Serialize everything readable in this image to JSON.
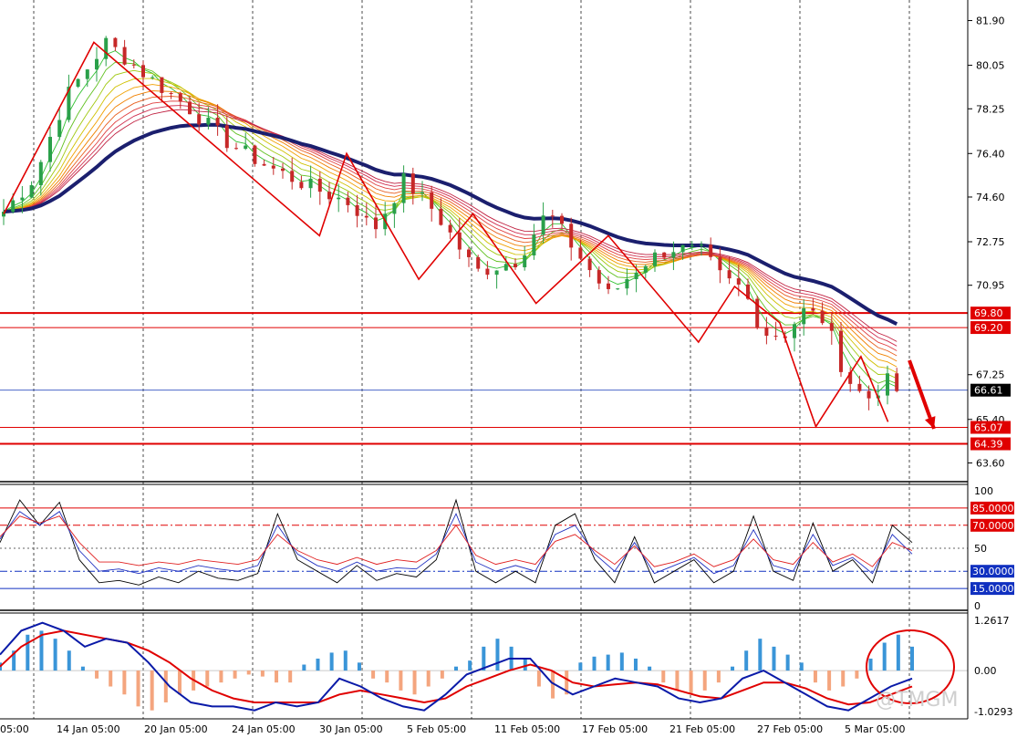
{
  "colors": {
    "background": "#ffffff",
    "grid": "#000000",
    "bull": "#2aa04a",
    "bear": "#c62828",
    "slow_ma": "#1b1f6e",
    "level_red": "#e00000",
    "current_price": "#3050c0",
    "rsi_black": "#000000",
    "rsi_blue": "#2030c0",
    "rsi_red": "#e02020",
    "macd_pos": "#3a95d8",
    "macd_neg": "#f4a57e",
    "macd_main": "#0a1aa8",
    "macd_signal": "#e00000"
  },
  "chart_data": [
    {
      "type": "candlestick",
      "panel": "price",
      "y_axis_ticks": [
        "81.90",
        "80.05",
        "78.25",
        "76.40",
        "74.60",
        "72.75",
        "70.95",
        "67.25",
        "65.40",
        "63.60"
      ],
      "ylim": [
        62.9,
        82.6
      ],
      "x_tick_labels": [
        "05:00",
        "14 Jan 05:00",
        "20 Jan 05:00",
        "24 Jan 05:00",
        "30 Jan 05:00",
        "5 Feb 05:00",
        "11 Feb 05:00",
        "17 Feb 05:00",
        "21 Feb 05:00",
        "27 Feb 05:00",
        "5 Mar 05:00"
      ],
      "price_path": [
        [
          0,
          74.0
        ],
        [
          3,
          75.4
        ],
        [
          6,
          78.7
        ],
        [
          10,
          81.0
        ],
        [
          14,
          79.6
        ],
        [
          18,
          78.3
        ],
        [
          22,
          76.8
        ],
        [
          26,
          75.8
        ],
        [
          30,
          75.0
        ],
        [
          34,
          74.3
        ],
        [
          36,
          73.2
        ],
        [
          39,
          75.3
        ],
        [
          42,
          74.0
        ],
        [
          46,
          71.5
        ],
        [
          50,
          72.0
        ],
        [
          53,
          74.0
        ],
        [
          56,
          72.2
        ],
        [
          59,
          70.5
        ],
        [
          62,
          71.8
        ],
        [
          65,
          72.5
        ],
        [
          68,
          72.3
        ],
        [
          70,
          71.2
        ],
        [
          72,
          70.8
        ],
        [
          74,
          69.0
        ],
        [
          76,
          68.9
        ],
        [
          78,
          69.9
        ],
        [
          80,
          69.5
        ],
        [
          82,
          67.2
        ],
        [
          84,
          66.2
        ],
        [
          86,
          67.0
        ],
        [
          87,
          66.6
        ]
      ],
      "horizontal_levels": [
        "69.80",
        "69.20",
        "65.07",
        "64.39"
      ],
      "current_price": "66.61",
      "zigzag": [
        [
          0,
          73.9
        ],
        [
          10,
          81.0
        ],
        [
          35,
          73.0
        ],
        [
          38,
          76.4
        ],
        [
          46,
          71.2
        ],
        [
          52,
          73.9
        ],
        [
          59,
          70.2
        ],
        [
          67,
          73.0
        ],
        [
          77,
          68.6
        ],
        [
          81,
          70.9
        ],
        [
          86,
          69.4
        ],
        [
          90,
          65.1
        ],
        [
          95,
          68.0
        ],
        [
          98,
          65.3
        ]
      ]
    },
    {
      "type": "line",
      "panel": "oscillator",
      "y_axis_ticks": [
        "100",
        "50",
        "0"
      ],
      "levels": [
        "85.0000",
        "70.0000",
        "30.0000",
        "15.0000"
      ],
      "ylim": [
        0,
        100
      ],
      "series": [
        {
          "values": [
            55,
            92,
            70,
            90,
            40,
            20,
            22,
            18,
            25,
            20,
            30,
            24,
            22,
            28,
            80,
            40,
            30,
            20,
            35,
            22,
            28,
            25,
            40,
            92,
            30,
            20,
            30,
            20,
            70,
            80,
            40,
            20,
            60,
            20,
            30,
            40,
            20,
            30,
            78,
            30,
            22,
            72,
            30,
            40,
            20,
            70,
            55
          ]
        },
        {
          "values": [
            58,
            82,
            70,
            82,
            48,
            30,
            32,
            28,
            33,
            30,
            35,
            32,
            30,
            35,
            70,
            45,
            35,
            30,
            38,
            30,
            33,
            32,
            45,
            80,
            38,
            30,
            35,
            30,
            62,
            70,
            45,
            30,
            55,
            28,
            35,
            42,
            28,
            35,
            66,
            35,
            30,
            62,
            35,
            42,
            28,
            62,
            45
          ]
        },
        {
          "values": [
            60,
            78,
            72,
            78,
            55,
            38,
            38,
            35,
            38,
            36,
            40,
            38,
            36,
            40,
            62,
            48,
            40,
            36,
            42,
            36,
            40,
            38,
            48,
            70,
            44,
            36,
            40,
            36,
            56,
            62,
            48,
            36,
            52,
            34,
            38,
            45,
            34,
            40,
            58,
            40,
            36,
            55,
            38,
            45,
            34,
            55,
            48
          ]
        }
      ]
    },
    {
      "type": "bar",
      "panel": "macd",
      "y_axis_ticks": [
        "1.2617",
        "0.00",
        "-1.0293"
      ],
      "ylim": [
        -1.0293,
        1.2617
      ],
      "histogram": [
        0.2,
        0.5,
        0.9,
        1.0,
        0.8,
        0.5,
        0.1,
        -0.2,
        -0.4,
        -0.6,
        -0.9,
        -1.0,
        -0.8,
        -0.6,
        -0.5,
        -0.4,
        -0.3,
        -0.2,
        -0.1,
        -0.15,
        -0.3,
        -0.3,
        0.15,
        0.3,
        0.45,
        0.5,
        0.2,
        -0.2,
        -0.3,
        -0.5,
        -0.6,
        -0.4,
        -0.2,
        0.1,
        0.25,
        0.6,
        0.8,
        0.6,
        0.3,
        -0.4,
        -0.7,
        -0.6,
        0.2,
        0.35,
        0.4,
        0.45,
        0.3,
        0.1,
        -0.3,
        -0.5,
        -0.6,
        -0.5,
        -0.3,
        0.1,
        0.5,
        0.8,
        0.6,
        0.4,
        0.2,
        -0.3,
        -0.5,
        -0.4,
        -0.2,
        0.3,
        0.7,
        0.9,
        0.6
      ],
      "macd_line": [
        0.4,
        1.0,
        1.2,
        1.0,
        0.6,
        0.8,
        0.7,
        0.2,
        -0.4,
        -0.8,
        -0.9,
        -0.9,
        -1.0,
        -0.8,
        -0.9,
        -0.8,
        -0.2,
        -0.4,
        -0.7,
        -0.9,
        -1.0,
        -0.6,
        -0.1,
        0.1,
        0.3,
        0.3,
        -0.3,
        -0.6,
        -0.4,
        -0.2,
        -0.3,
        -0.4,
        -0.7,
        -0.8,
        -0.7,
        -0.2,
        0.0,
        -0.3,
        -0.6,
        -0.9,
        -1.0,
        -0.7,
        -0.4,
        -0.2
      ],
      "signal_line": [
        0.1,
        0.6,
        0.9,
        1.0,
        0.9,
        0.8,
        0.7,
        0.5,
        0.2,
        -0.2,
        -0.5,
        -0.7,
        -0.8,
        -0.8,
        -0.8,
        -0.8,
        -0.6,
        -0.5,
        -0.6,
        -0.7,
        -0.8,
        -0.7,
        -0.4,
        -0.2,
        0.0,
        0.15,
        0.0,
        -0.3,
        -0.4,
        -0.35,
        -0.3,
        -0.35,
        -0.5,
        -0.65,
        -0.7,
        -0.5,
        -0.3,
        -0.3,
        -0.45,
        -0.7,
        -0.85,
        -0.8,
        -0.6,
        -0.4
      ]
    }
  ],
  "watermark": "@TMGM"
}
